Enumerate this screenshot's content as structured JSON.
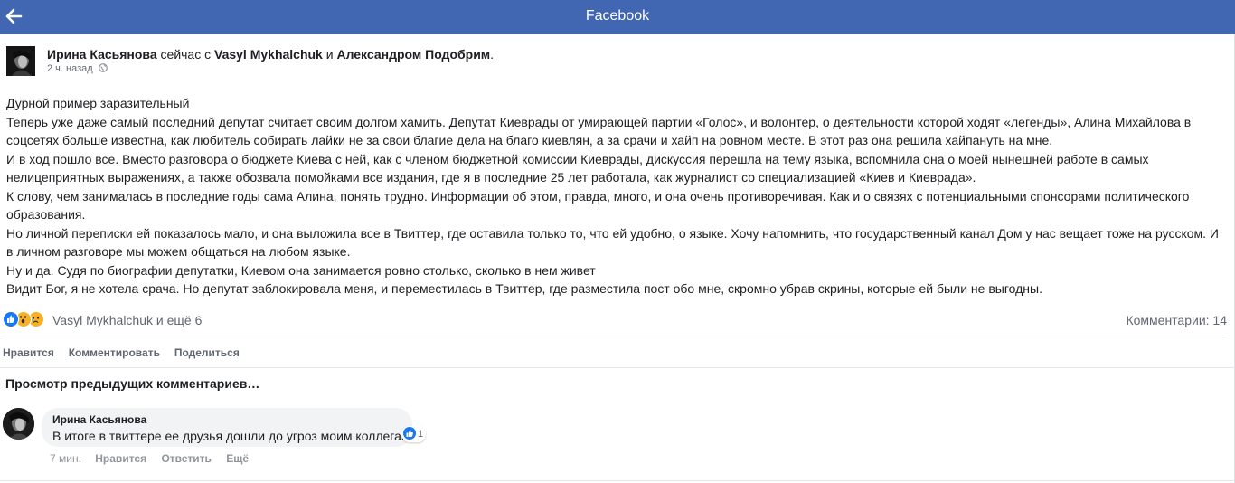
{
  "app": {
    "title": "Facebook"
  },
  "post": {
    "author": "Ирина Касьянова",
    "with_text": "сейчас с",
    "tagged_1": "Vasyl Mykhalchuk",
    "and_text": "и",
    "tagged_2": "Александром Подобрим",
    "end_dot": ".",
    "time": "2 ч. назад",
    "paragraphs": [
      "Дурной пример заразительный",
      "Теперь уже даже самый последний депутат считает своим долгом хамить. Депутат Киеврады от умирающей партии «Голос», и волонтер, о деятельности которой ходят «легенды», Алина Михайлова в соцсетях больше известна, как любитель собирать лайки не за свои благие дела на благо киевлян, а за срачи и хайп на ровном месте. В этот раз она решила хайпануть на мне.",
      "И в ход пошло все. Вместо разговора о бюджете Киева с ней, как с членом бюджетной комиссии Киеврады, дискуссия перешла на тему языка, вспомнила она о моей нынешней работе в самых нелицеприятных выражениях, а также обозвала помойками все издания, где я в последние 25 лет работала, как журналист со специализацией «Киев и Киеврада».",
      "К слову, чем занималась в последние годы сама Алина, понять трудно. Информации об этом, правда, много, и она очень противоречивая. Как и о связях с потенциальными спонсорами политического образования.",
      "Но личной переписки ей показалось мало, и она выложила все в Твиттер, где оставила только то, что ей удобно, о языке. Хочу напомнить, что государственный канал Дом у нас вещает тоже на русском. И в личном разговоре мы можем общаться на любом языке.",
      "Ну и да. Судя по биографии депутатки, Киевом она занимается ровно столько, сколько в нем живет",
      "Видит Бог, я не хотела срача. Но депутат заблокировала меня, и переместилась в Твиттер, где разместила пост обо мне, скромно убрав скрины, которые ей были не выгодны."
    ],
    "reactions_text": "Vasyl Mykhalchuk и ещё 6",
    "comments_count": "Комментарии: 14"
  },
  "actions": {
    "like": "Нравится",
    "comment": "Комментировать",
    "share": "Поделиться"
  },
  "view_previous": "Просмотр предыдущих комментариев…",
  "comment": {
    "author": "Ирина Касьянова",
    "text": "В итоге в твиттере ее друзья дошли до угроз моим коллегам",
    "likes": "1",
    "time": "7 мин.",
    "like": "Нравится",
    "reply": "Ответить",
    "more": "Ещё"
  },
  "colors": {
    "header_bg": "#4267b2",
    "like_blue": "#1877f2",
    "bubble_bg": "#f2f3f5",
    "muted_text": "#606770"
  },
  "icons": {
    "back": "arrow-left-icon",
    "privacy": "globe-icon",
    "reactions": [
      "like-reaction-icon",
      "wow-reaction-icon",
      "sad-reaction-icon"
    ]
  }
}
